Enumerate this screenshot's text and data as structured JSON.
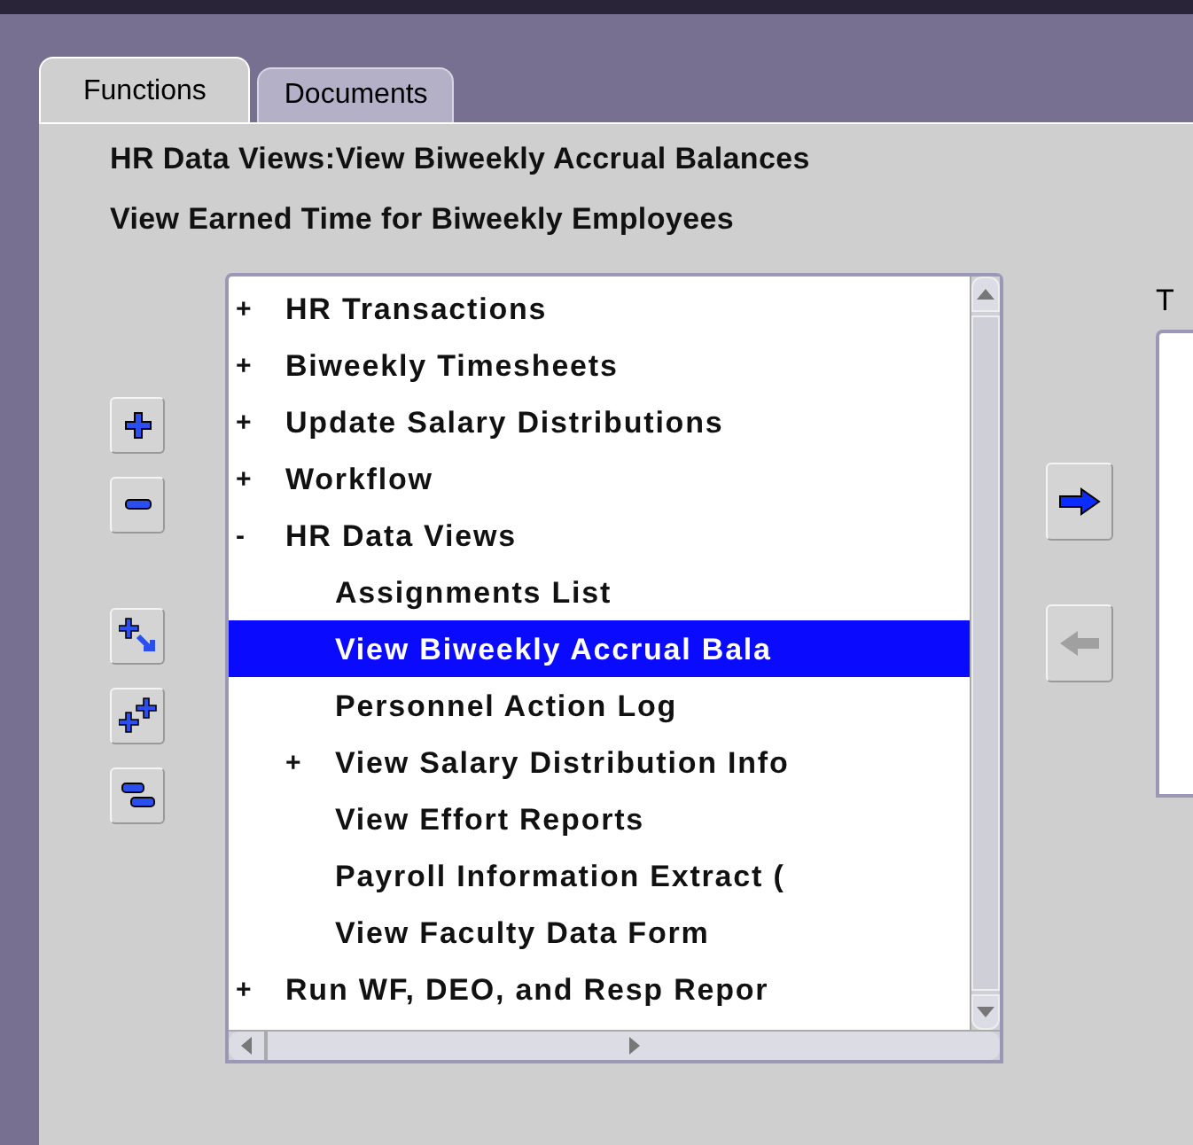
{
  "tabs": [
    {
      "label": "Functions",
      "selected": true
    },
    {
      "label": "Documents",
      "selected": false
    }
  ],
  "heading": "HR Data Views:View Biweekly Accrual Balances",
  "description": "View Earned Time for Biweekly Employees",
  "tree": [
    {
      "marker": "+",
      "label": "HR Transactions",
      "selected": false
    },
    {
      "marker": "+",
      "label": "Biweekly Timesheets",
      "selected": false
    },
    {
      "marker": "+",
      "label": "Update Salary Distributions",
      "selected": false
    },
    {
      "marker": "+",
      "label": "Workflow",
      "selected": false
    },
    {
      "marker": "-",
      "label": "HR Data Views",
      "selected": false,
      "children": [
        {
          "label": "Assignments List",
          "selected": false
        },
        {
          "label": "View Biweekly Accrual Bala",
          "selected": true
        },
        {
          "label": "Personnel Action Log",
          "selected": false
        },
        {
          "marker": "+",
          "label": "View Salary Distribution Info",
          "selected": false
        },
        {
          "label": "View Effort Reports",
          "selected": false
        },
        {
          "label": "Payroll Information Extract (",
          "selected": false
        },
        {
          "label": "View Faculty Data Form",
          "selected": false
        }
      ]
    },
    {
      "marker": "+",
      "label": "Run WF, DEO, and Resp Repor",
      "selected": false
    }
  ],
  "add_button": {
    "disabled": false
  },
  "remove_button": {
    "disabled": true
  },
  "target_label": "T"
}
